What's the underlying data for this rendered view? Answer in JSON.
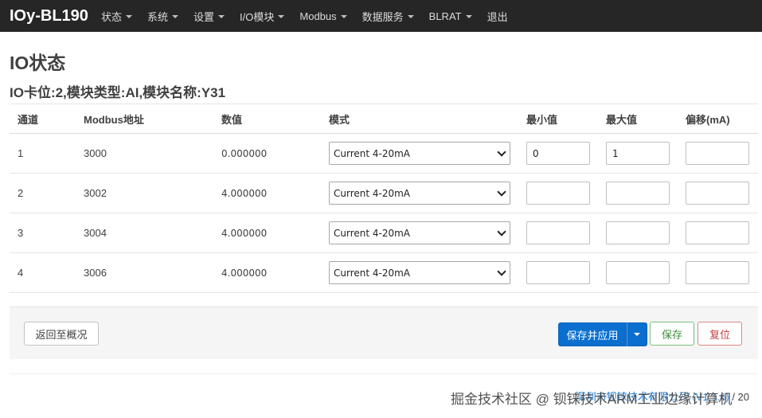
{
  "navbar": {
    "brand": "IOy-BL190",
    "items": [
      {
        "label": "状态",
        "dropdown": true
      },
      {
        "label": "系统",
        "dropdown": true
      },
      {
        "label": "设置",
        "dropdown": true
      },
      {
        "label": "I/O模块",
        "dropdown": true
      },
      {
        "label": "Modbus",
        "dropdown": true
      },
      {
        "label": "数据服务",
        "dropdown": true
      },
      {
        "label": "BLRAT",
        "dropdown": true
      },
      {
        "label": "退出",
        "dropdown": false
      }
    ]
  },
  "page": {
    "title": "IO状态",
    "subtitle": "IO卡位:2,模块类型:AI,模块名称:Y31"
  },
  "table": {
    "headers": [
      "通道",
      "Modbus地址",
      "数值",
      "模式",
      "最小值",
      "最大值",
      "偏移(mA)"
    ],
    "rows": [
      {
        "channel": "1",
        "address": "3000",
        "value": "0.000000",
        "mode": "Current 4-20mA",
        "min": "0",
        "max": "1",
        "offset": ""
      },
      {
        "channel": "2",
        "address": "3002",
        "value": "4.000000",
        "mode": "Current 4-20mA",
        "min": "",
        "max": "",
        "offset": ""
      },
      {
        "channel": "3",
        "address": "3004",
        "value": "4.000000",
        "mode": "Current 4-20mA",
        "min": "",
        "max": "",
        "offset": ""
      },
      {
        "channel": "4",
        "address": "3006",
        "value": "4.000000",
        "mode": "Current 4-20mA",
        "min": "",
        "max": "",
        "offset": ""
      }
    ]
  },
  "actions": {
    "back": "返回至概况",
    "save_apply": "保存并应用",
    "save": "保存",
    "reset": "复位"
  },
  "footer": {
    "company": "深圳市钡铼技术有限公司",
    "version": "(V1.1.6)",
    "separator": "/ 20",
    "watermark": "掘金技术社区 @ 钡铼技术ARM工业边缘计算机"
  },
  "colors": {
    "navbar_bg": "#262626",
    "primary": "#0a6fcf",
    "save_green": "#3d8f3d",
    "reset_red": "#c24040",
    "link": "#0a6fcf"
  }
}
